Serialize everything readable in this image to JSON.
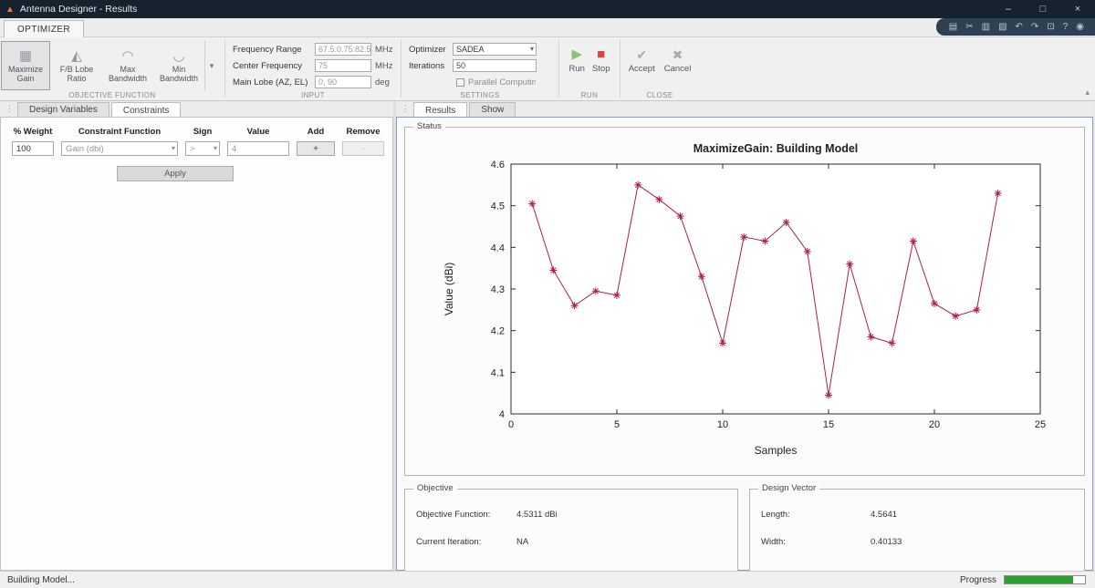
{
  "window": {
    "title": "Antenna Designer - Results",
    "status_left": "Building Model...",
    "progress_label": "Progress",
    "progress_percent": 85
  },
  "icons": {
    "app": "▲",
    "minimize": "–",
    "maximize": "□",
    "close": "×",
    "run": "▶",
    "stop": "■",
    "accept": "✔",
    "cancel": "✖",
    "dropdown": "▾",
    "collapse_ribbon": "▴",
    "tab_handle": "⋮",
    "maximize_gain": "▦",
    "fb_lobe_ratio": "◭",
    "max_bandwidth": "◠",
    "min_bandwidth": "◡",
    "quick_access": [
      "▤",
      "✂",
      "▥",
      "▧",
      "↶",
      "↷",
      "⊡",
      "?",
      "◉"
    ]
  },
  "ribbon": {
    "tab_label": "OPTIMIZER",
    "objective": {
      "group_label": "OBJECTIVE FUNCTION",
      "buttons": [
        {
          "label": "Maximize Gain"
        },
        {
          "label": "F/B Lobe Ratio"
        },
        {
          "label": "Max Bandwidth"
        },
        {
          "label": "Min Bandwidth"
        }
      ]
    },
    "input": {
      "group_label": "INPUT",
      "fields": [
        {
          "label": "Frequency Range",
          "value": "67.5:0.75:82.5",
          "unit": "MHz"
        },
        {
          "label": "Center Frequency",
          "value": "75",
          "unit": "MHz"
        },
        {
          "label": "Main Lobe (AZ, EL)",
          "value": "0, 90",
          "unit": "deg"
        }
      ]
    },
    "settings": {
      "group_label": "SETTINGS",
      "optimizer_label": "Optimizer",
      "optimizer_value": "SADEA",
      "iterations_label": "Iterations",
      "iterations_value": "50",
      "parallel_label": "Parallel Computing"
    },
    "run": {
      "group_label": "RUN",
      "run_label": "Run",
      "stop_label": "Stop"
    },
    "close": {
      "group_label": "CLOSE",
      "accept_label": "Accept",
      "cancel_label": "Cancel"
    }
  },
  "left": {
    "tabs": [
      "Design Variables",
      "Constraints"
    ],
    "headers": [
      "% Weight",
      "Constraint Function",
      "Sign",
      "Value",
      "Add",
      "Remove"
    ],
    "row": {
      "weight": "100",
      "function": "Gain (dbi)",
      "sign": ">",
      "value": "4",
      "add": "+",
      "remove": "-"
    },
    "apply_label": "Apply"
  },
  "right": {
    "tabs": [
      "Results",
      "Show"
    ],
    "status_group_label": "Status",
    "objective_group": {
      "title": "Objective",
      "rows": [
        {
          "label": "Objective Function:",
          "value": "4.5311 dBi"
        },
        {
          "label": "Current Iteration:",
          "value": "NA"
        }
      ]
    },
    "design_group": {
      "title": "Design Vector",
      "rows": [
        {
          "label": "Length:",
          "value": "4.5641"
        },
        {
          "label": "Width:",
          "value": "0.40133"
        }
      ]
    }
  },
  "chart_data": {
    "type": "line",
    "title": "MaximizeGain: Building Model",
    "xlabel": "Samples",
    "ylabel": "Value (dBi)",
    "xlim": [
      0,
      25
    ],
    "ylim": [
      4,
      4.6
    ],
    "xticks": [
      0,
      5,
      10,
      15,
      20,
      25
    ],
    "yticks": [
      4,
      4.1,
      4.2,
      4.3,
      4.4,
      4.5,
      4.6
    ],
    "line_color": "#b01e41",
    "marker": "asterisk",
    "grid": false,
    "x": [
      1,
      2,
      3,
      4,
      5,
      6,
      7,
      8,
      9,
      10,
      11,
      12,
      13,
      14,
      15,
      16,
      17,
      18,
      19,
      20,
      21,
      22,
      23
    ],
    "y": [
      4.505,
      4.345,
      4.26,
      4.295,
      4.285,
      4.55,
      4.515,
      4.475,
      4.33,
      4.17,
      4.425,
      4.415,
      4.46,
      4.39,
      4.045,
      4.36,
      4.185,
      4.17,
      4.415,
      4.265,
      4.235,
      4.25,
      4.53
    ]
  }
}
